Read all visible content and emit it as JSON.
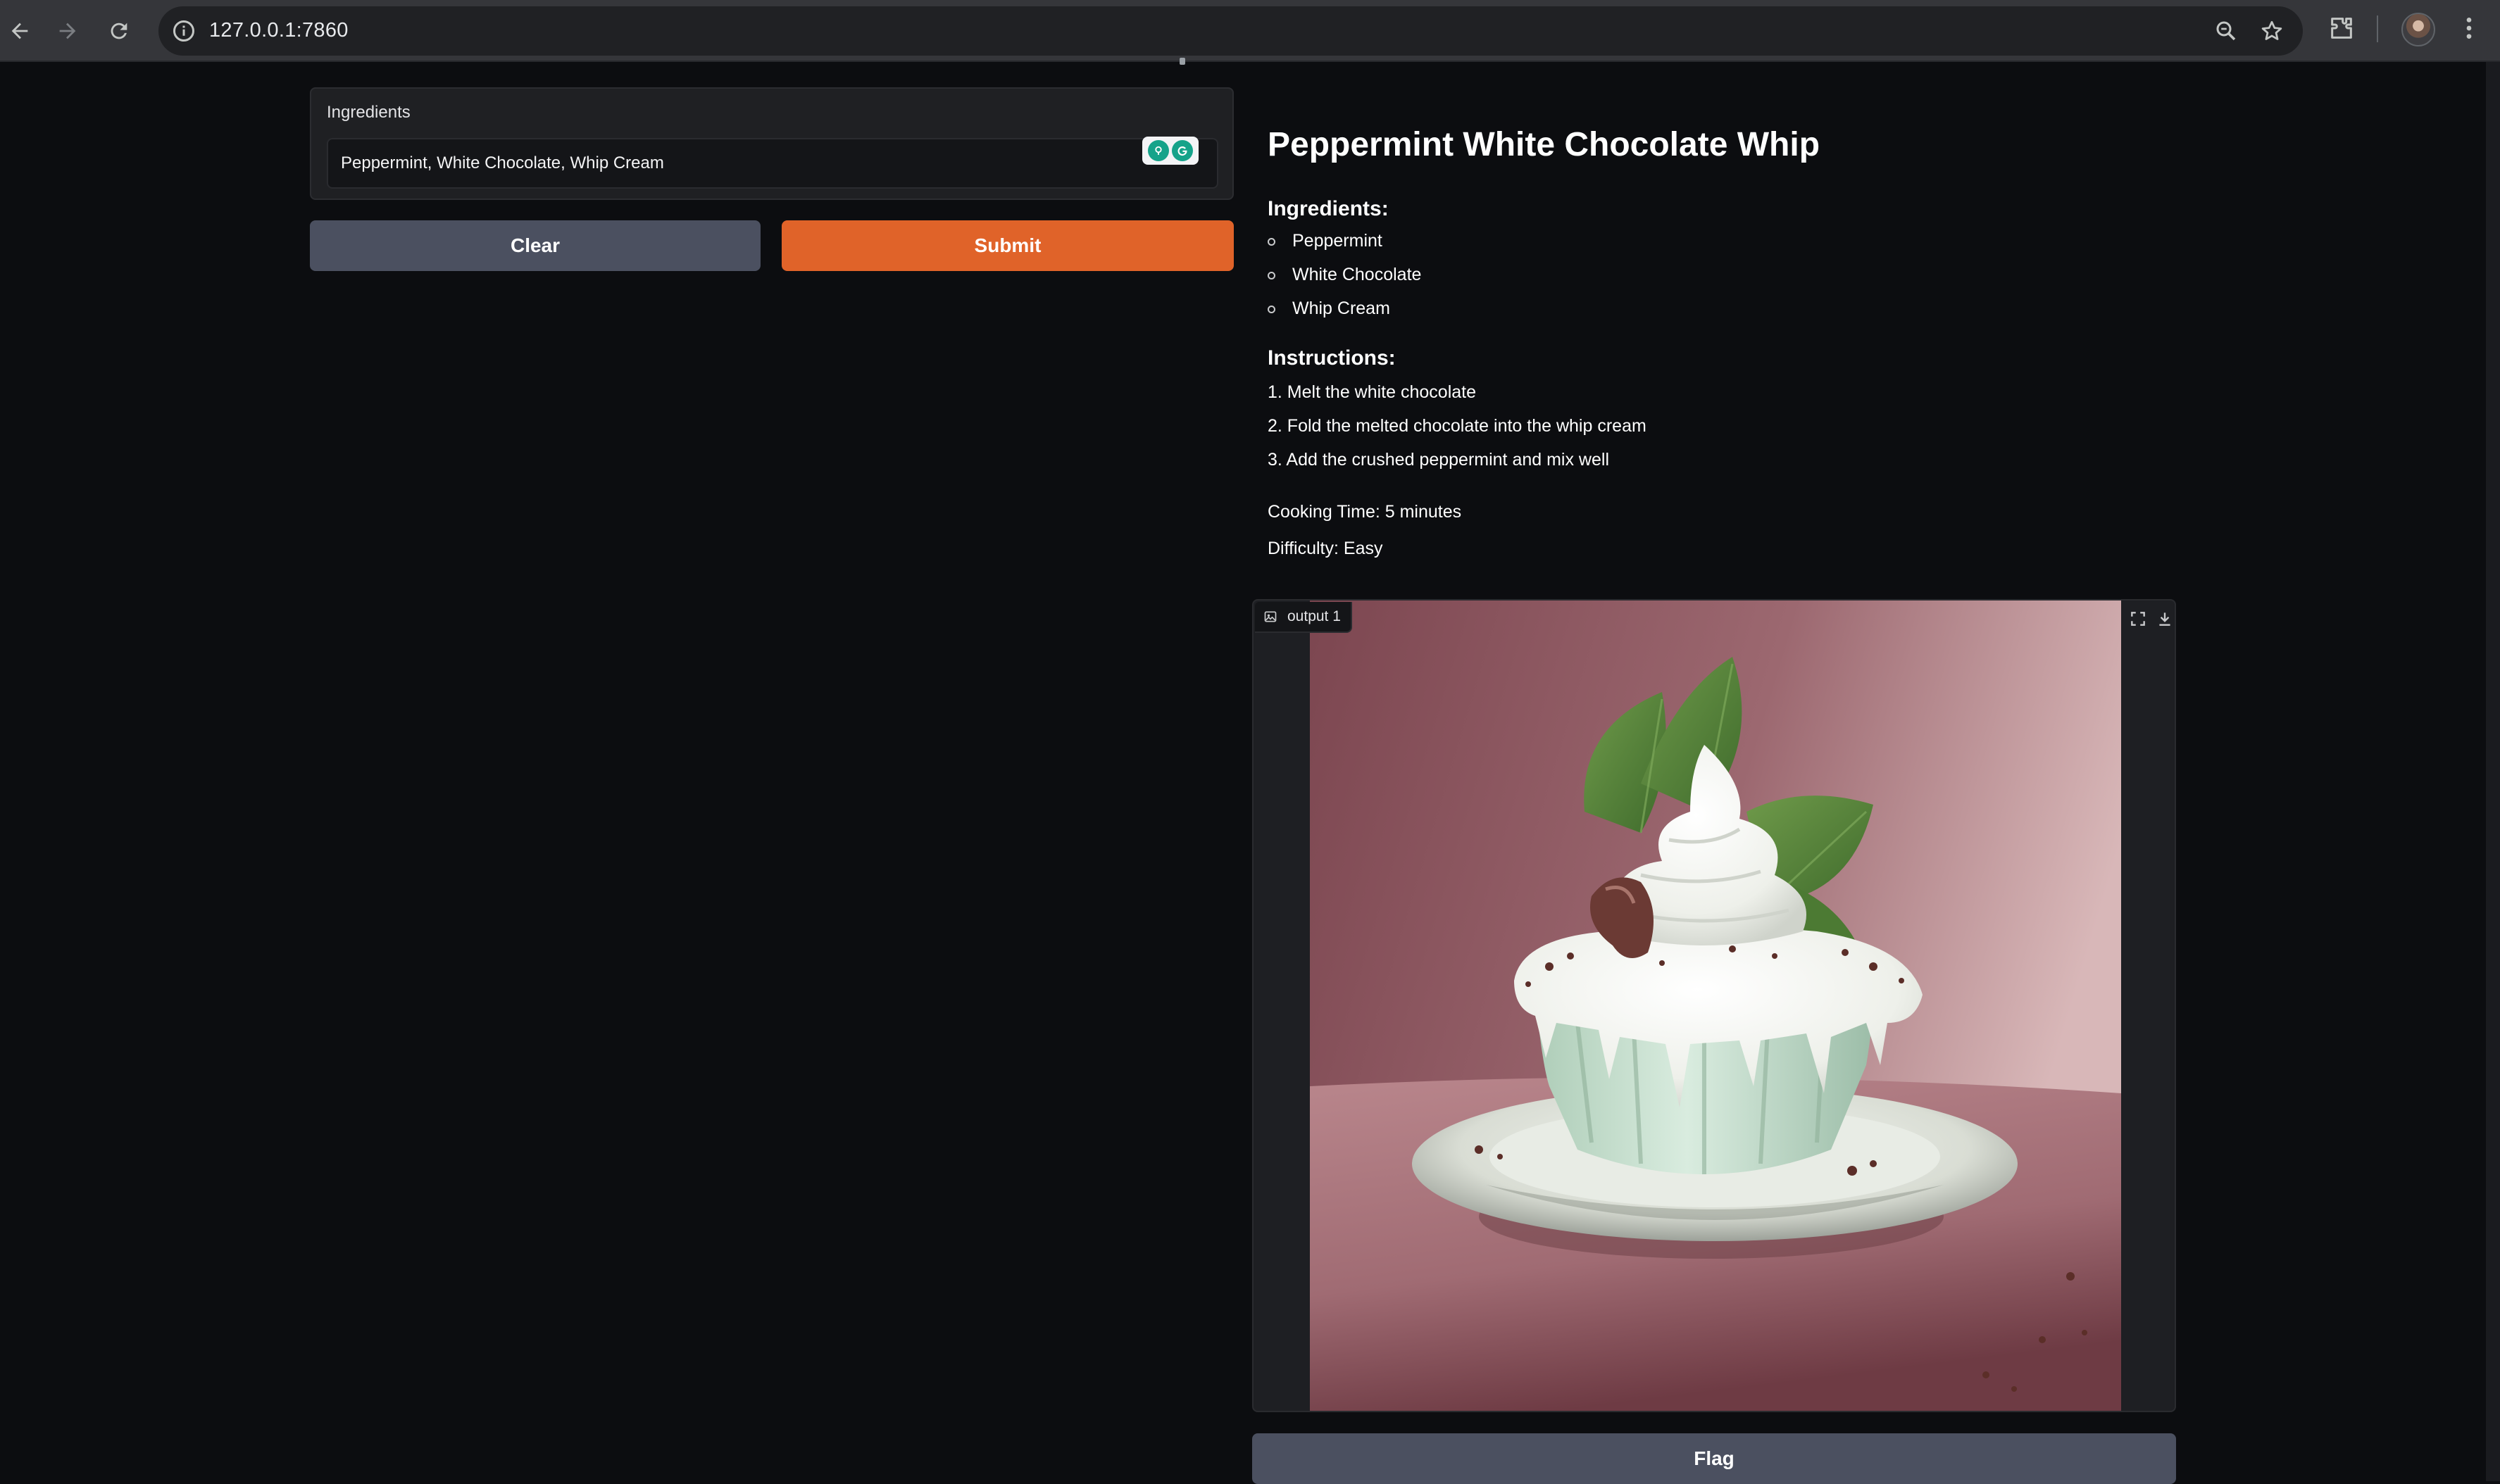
{
  "browser": {
    "url": "127.0.0.1:7860"
  },
  "input": {
    "label": "Ingredients",
    "value": "Peppermint, White Chocolate, Whip Cream"
  },
  "actions": {
    "clear_label": "Clear",
    "submit_label": "Submit",
    "flag_label": "Flag"
  },
  "recipe": {
    "title": "Peppermint White Chocolate Whip",
    "ingredients_heading": "Ingredients:",
    "ingredients": [
      "Peppermint",
      "White Chocolate",
      "Whip Cream"
    ],
    "instructions_heading": "Instructions:",
    "instructions": [
      "1. Melt the white chocolate",
      "2. Fold the melted chocolate into the whip cream",
      "3. Add the crushed peppermint and mix well"
    ],
    "cooking_time": "Cooking Time: 5 minutes",
    "difficulty": "Difficulty: Easy"
  },
  "image_output": {
    "label": "output 1"
  },
  "colors": {
    "primary": "#e06329",
    "secondary": "#4b5060",
    "background": "#0c0d10"
  }
}
